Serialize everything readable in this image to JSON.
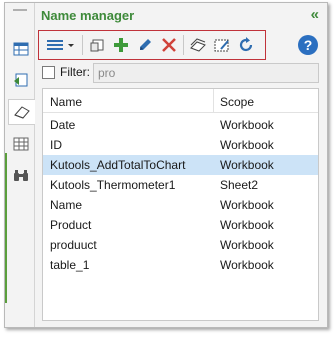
{
  "panel": {
    "title": "Name manager",
    "collapse_glyph": "«"
  },
  "rail": {
    "icons": [
      "workbook-icon",
      "sheet-icon",
      "eraser-icon",
      "grid-icon",
      "binoculars-icon"
    ],
    "active_index": 2
  },
  "toolbar": {
    "buttons": [
      "list-menu-icon",
      "export-names-icon",
      "add-icon",
      "edit-icon",
      "delete-icon",
      "stack-icon",
      "range-edit-icon",
      "refresh-icon"
    ],
    "help_glyph": "?"
  },
  "filter": {
    "label": "Filter:",
    "value": "pro"
  },
  "list": {
    "columns": {
      "name": "Name",
      "scope": "Scope"
    },
    "rows": [
      {
        "name": "Date",
        "scope": "Workbook"
      },
      {
        "name": "ID",
        "scope": "Workbook"
      },
      {
        "name": "Kutools_AddTotalToChart",
        "scope": "Workbook",
        "selected": true
      },
      {
        "name": "Kutools_Thermometer1",
        "scope": "Sheet2"
      },
      {
        "name": "Name",
        "scope": "Workbook"
      },
      {
        "name": "Product",
        "scope": "Workbook"
      },
      {
        "name": "produuct",
        "scope": "Workbook"
      },
      {
        "name": "table_1",
        "scope": "Workbook"
      }
    ]
  },
  "colors": {
    "accent_green": "#3e8a3a",
    "toolbar_highlight": "#c0323a",
    "selection": "#cce3f7"
  }
}
